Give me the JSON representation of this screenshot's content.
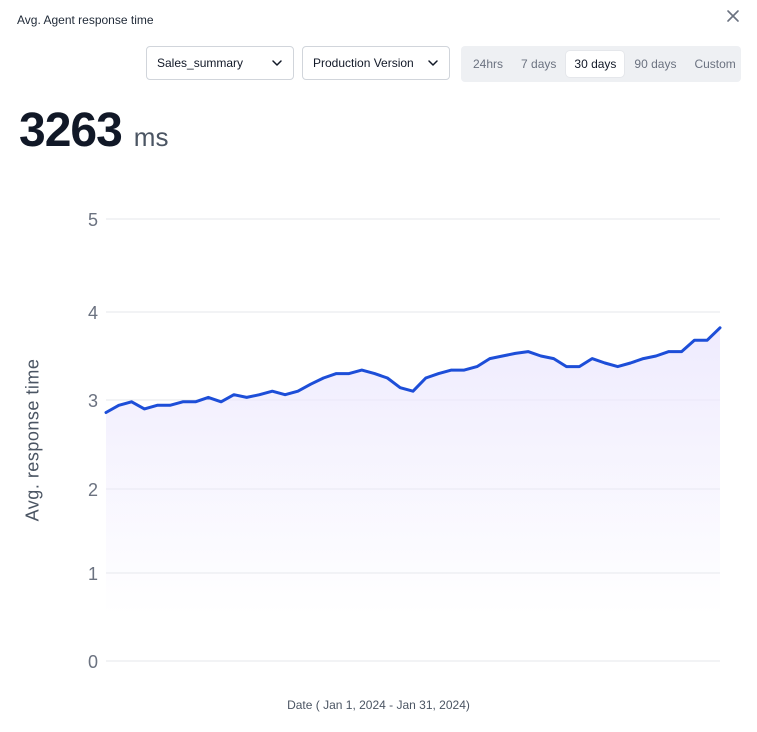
{
  "header": {
    "title": "Avg. Agent response time"
  },
  "filters": {
    "summary_select": "Sales_summary",
    "version_select": "Production Version"
  },
  "range_tabs": [
    {
      "label": "24hrs",
      "active": false
    },
    {
      "label": "7 days",
      "active": false
    },
    {
      "label": "30 days",
      "active": true
    },
    {
      "label": "90 days",
      "active": false
    },
    {
      "label": "Custom",
      "active": false
    }
  ],
  "metric": {
    "value": "3263",
    "unit": "ms"
  },
  "colors": {
    "line": "#1d4ed8",
    "fill": "#ede9fe",
    "grid": "#e5e7eb",
    "tick": "#6b7280"
  },
  "chart_data": {
    "type": "area",
    "title": "",
    "xlabel": "Date ( Jan 1, 2024 - Jan 31, 2024)",
    "ylabel": "Avg. response time",
    "ylim": [
      0,
      5
    ],
    "yticks": [
      0,
      1,
      2,
      3,
      4,
      5
    ],
    "grid": true,
    "series": [
      {
        "values": [
          2.86,
          2.94,
          2.98,
          2.9,
          2.94,
          2.94,
          2.98,
          2.98,
          3.03,
          2.98,
          3.06,
          3.03,
          3.06,
          3.1,
          3.06,
          3.1,
          3.18,
          3.25,
          3.3,
          3.3,
          3.34,
          3.3,
          3.25,
          3.14,
          3.1,
          3.25,
          3.3,
          3.34,
          3.34,
          3.38,
          3.47,
          3.5,
          3.53,
          3.55,
          3.5,
          3.47,
          3.38,
          3.38,
          3.47,
          3.42,
          3.38,
          3.42,
          3.47,
          3.5,
          3.55,
          3.55,
          3.68,
          3.68,
          3.82
        ]
      }
    ]
  }
}
